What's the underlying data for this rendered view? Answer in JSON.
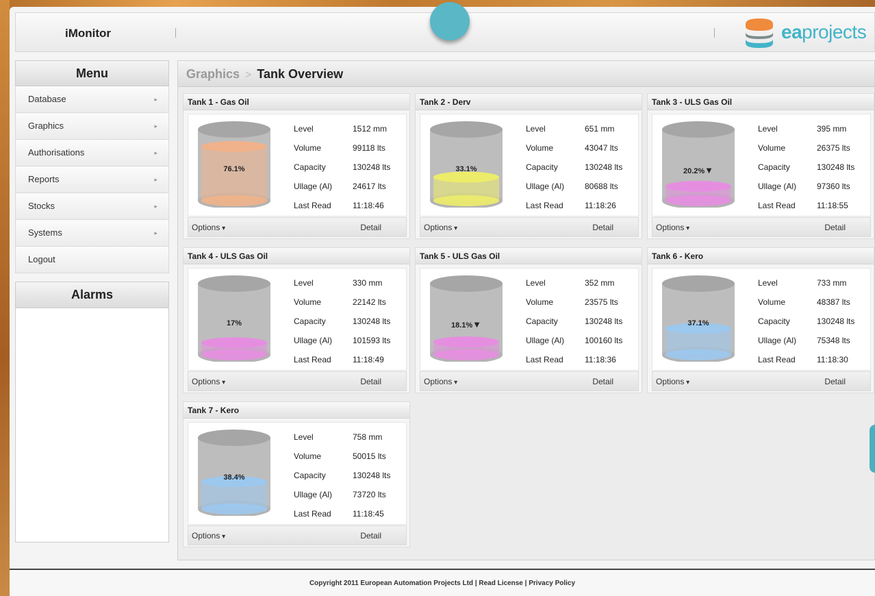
{
  "app": {
    "title": "iMonitor",
    "logo_prefix": "ea",
    "logo_suffix": "projects"
  },
  "menu": {
    "title": "Menu",
    "items": [
      {
        "label": "Database",
        "arrow": "▸"
      },
      {
        "label": "Graphics",
        "arrow": "▸"
      },
      {
        "label": "Authorisations",
        "arrow": "▸"
      },
      {
        "label": "Reports",
        "arrow": "▸"
      },
      {
        "label": "Stocks",
        "arrow": "▸"
      },
      {
        "label": "Systems",
        "arrow": "▸"
      },
      {
        "label": "Logout",
        "arrow": ""
      }
    ]
  },
  "alarms": {
    "title": "Alarms"
  },
  "breadcrumb": {
    "parent": "Graphics",
    "separator": ">",
    "current": "Tank Overview"
  },
  "labels": {
    "level": "Level",
    "volume": "Volume",
    "capacity": "Capacity",
    "ullage": "Ullage (Al)",
    "last_read": "Last Read",
    "options": "Options",
    "detail": "Detail"
  },
  "tanks": [
    {
      "title": "Tank 1 - Gas Oil",
      "percent": "76.1%",
      "fill": 0.761,
      "trend": "",
      "color": "#f0b28a",
      "level": "1512 mm",
      "volume": "99118 lts",
      "capacity": "130248 lts",
      "ullage": "24617 lts",
      "last_read": "11:18:46"
    },
    {
      "title": "Tank 2 - Derv",
      "percent": "33.1%",
      "fill": 0.331,
      "trend": "",
      "color": "#ecec6a",
      "level": "651 mm",
      "volume": "43047 lts",
      "capacity": "130248 lts",
      "ullage": "80688 lts",
      "last_read": "11:18:26"
    },
    {
      "title": "Tank 3 - ULS Gas Oil",
      "percent": "20.2%",
      "fill": 0.202,
      "trend": "▼",
      "color": "#e58ee0",
      "level": "395 mm",
      "volume": "26375 lts",
      "capacity": "130248 lts",
      "ullage": "97360 lts",
      "last_read": "11:18:55"
    },
    {
      "title": "Tank 4 - ULS Gas Oil",
      "percent": "17%",
      "fill": 0.17,
      "trend": "",
      "color": "#e58ee0",
      "level": "330 mm",
      "volume": "22142 lts",
      "capacity": "130248 lts",
      "ullage": "101593 lts",
      "last_read": "11:18:49"
    },
    {
      "title": "Tank 5 - ULS Gas Oil",
      "percent": "18.1%",
      "fill": 0.181,
      "trend": "▼",
      "color": "#e58ee0",
      "level": "352 mm",
      "volume": "23575 lts",
      "capacity": "130248 lts",
      "ullage": "100160 lts",
      "last_read": "11:18:36"
    },
    {
      "title": "Tank 6 - Kero",
      "percent": "37.1%",
      "fill": 0.371,
      "trend": "",
      "color": "#9cc8ee",
      "level": "733 mm",
      "volume": "48387 lts",
      "capacity": "130248 lts",
      "ullage": "75348 lts",
      "last_read": "11:18:30"
    },
    {
      "title": "Tank 7 - Kero",
      "percent": "38.4%",
      "fill": 0.384,
      "trend": "",
      "color": "#9cc8ee",
      "level": "758 mm",
      "volume": "50015 lts",
      "capacity": "130248 lts",
      "ullage": "73720 lts",
      "last_read": "11:18:45"
    }
  ],
  "footer": {
    "text": "Copyright 2011 European Automation Projects Ltd | Read License | Privacy Policy"
  }
}
